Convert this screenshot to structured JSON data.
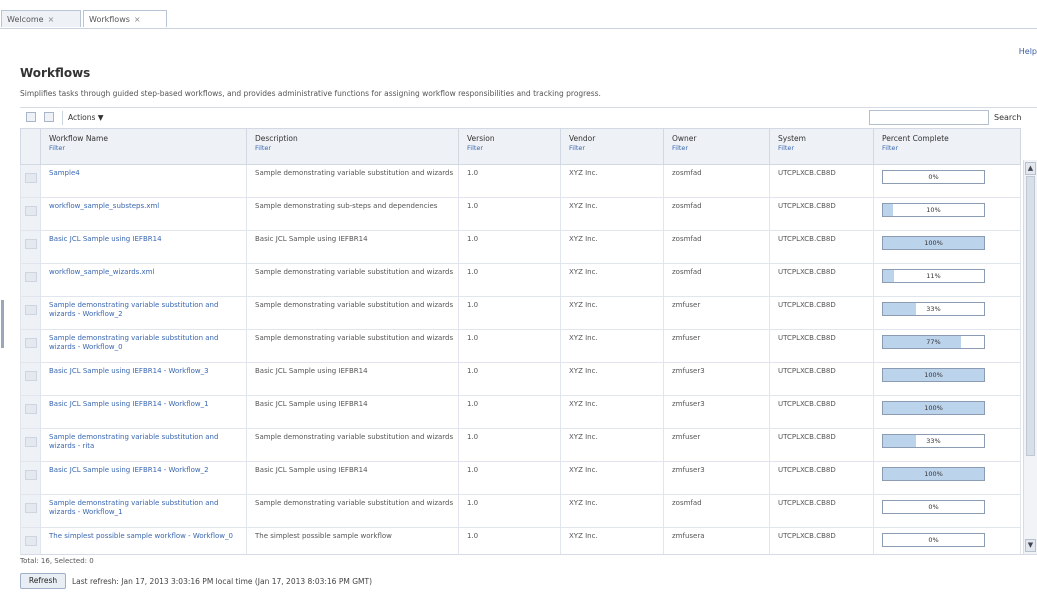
{
  "tabs": [
    {
      "label": "Welcome",
      "close": "×"
    },
    {
      "label": "Workflows",
      "close": "×"
    }
  ],
  "help_link": "Help",
  "page": {
    "title": "Workflows",
    "description": "Simplifies tasks through guided step-based workflows, and provides administrative functions for assigning workflow responsibilities and tracking progress."
  },
  "toolbar": {
    "actions_label": "Actions ▼",
    "search_label": "Search",
    "search_value": ""
  },
  "table": {
    "columns": [
      {
        "label": "Workflow Name",
        "filter": "Filter"
      },
      {
        "label": "Description",
        "filter": "Filter"
      },
      {
        "label": "Version",
        "filter": "Filter"
      },
      {
        "label": "Vendor",
        "filter": "Filter"
      },
      {
        "label": "Owner",
        "filter": "Filter"
      },
      {
        "label": "System",
        "filter": "Filter"
      },
      {
        "label": "Percent Complete",
        "filter": "Filter"
      }
    ],
    "rows": [
      {
        "name": "Sample4",
        "description": "Sample demonstrating variable substitution and wizards",
        "version": "1.0",
        "vendor": "XYZ Inc.",
        "owner": "zosmfad",
        "system": "UTCPLXCB.CB8D",
        "percent": 0,
        "percent_label": "0%"
      },
      {
        "name": "workflow_sample_substeps.xml",
        "description": "Sample demonstrating sub-steps and dependencies",
        "version": "1.0",
        "vendor": "XYZ Inc.",
        "owner": "zosmfad",
        "system": "UTCPLXCB.CB8D",
        "percent": 10,
        "percent_label": "10%"
      },
      {
        "name": "Basic JCL Sample using IEFBR14",
        "description": "Basic JCL Sample using IEFBR14",
        "version": "1.0",
        "vendor": "XYZ Inc.",
        "owner": "zosmfad",
        "system": "UTCPLXCB.CB8D",
        "percent": 100,
        "percent_label": "100%"
      },
      {
        "name": "workflow_sample_wizards.xml",
        "description": "Sample demonstrating variable substitution and wizards",
        "version": "1.0",
        "vendor": "XYZ Inc.",
        "owner": "zosmfad",
        "system": "UTCPLXCB.CB8D",
        "percent": 11,
        "percent_label": "11%"
      },
      {
        "name": "Sample demonstrating variable substitution and wizards - Workflow_2",
        "description": "Sample demonstrating variable substitution and wizards",
        "version": "1.0",
        "vendor": "XYZ Inc.",
        "owner": "zmfuser",
        "system": "UTCPLXCB.CB8D",
        "percent": 33,
        "percent_label": "33%"
      },
      {
        "name": "Sample demonstrating variable substitution and wizards - Workflow_0",
        "description": "Sample demonstrating variable substitution and wizards",
        "version": "1.0",
        "vendor": "XYZ Inc.",
        "owner": "zmfuser",
        "system": "UTCPLXCB.CB8D",
        "percent": 77,
        "percent_label": "77%"
      },
      {
        "name": "Basic JCL Sample using IEFBR14 - Workflow_3",
        "description": "Basic JCL Sample using IEFBR14",
        "version": "1.0",
        "vendor": "XYZ Inc.",
        "owner": "zmfuser3",
        "system": "UTCPLXCB.CB8D",
        "percent": 100,
        "percent_label": "100%"
      },
      {
        "name": "Basic JCL Sample using IEFBR14 - Workflow_1",
        "description": "Basic JCL Sample using IEFBR14",
        "version": "1.0",
        "vendor": "XYZ Inc.",
        "owner": "zmfuser3",
        "system": "UTCPLXCB.CB8D",
        "percent": 100,
        "percent_label": "100%"
      },
      {
        "name": "Sample demonstrating variable substitution and wizards - rita",
        "description": "Sample demonstrating variable substitution and wizards",
        "version": "1.0",
        "vendor": "XYZ Inc.",
        "owner": "zmfuser",
        "system": "UTCPLXCB.CB8D",
        "percent": 33,
        "percent_label": "33%"
      },
      {
        "name": "Basic JCL Sample using IEFBR14 - Workflow_2",
        "description": "Basic JCL Sample using IEFBR14",
        "version": "1.0",
        "vendor": "XYZ Inc.",
        "owner": "zmfuser3",
        "system": "UTCPLXCB.CB8D",
        "percent": 100,
        "percent_label": "100%"
      },
      {
        "name": "Sample demonstrating variable substitution and wizards - Workflow_1",
        "description": "Sample demonstrating variable substitution and wizards",
        "version": "1.0",
        "vendor": "XYZ Inc.",
        "owner": "zosmfad",
        "system": "UTCPLXCB.CB8D",
        "percent": 0,
        "percent_label": "0%"
      },
      {
        "name": "The simplest possible sample workflow - Workflow_0",
        "description": "The simplest possible sample workflow",
        "version": "1.0",
        "vendor": "XYZ Inc.",
        "owner": "zmfusera",
        "system": "UTCPLXCB.CB8D",
        "percent": 0,
        "percent_label": "0%"
      }
    ]
  },
  "footer": {
    "total_text": "Total: 16, Selected: 0",
    "refresh_label": "Refresh",
    "last_refresh": "Last refresh: Jan 17, 2013 3:03:16 PM local time (Jan 17, 2013 8:03:16 PM GMT)"
  }
}
